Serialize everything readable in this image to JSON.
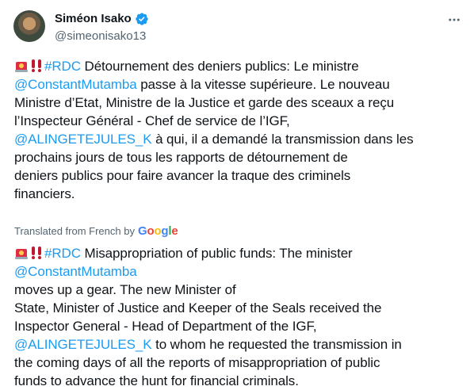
{
  "author": {
    "name": "Siméon Isako",
    "handle": "@simeonisako13"
  },
  "icons": {
    "siren": "police-car-light",
    "exclaim": "double-exclamation",
    "verified": "verified-badge",
    "more": "more-dots"
  },
  "colors": {
    "link": "#1d9bf0",
    "muted": "#536471",
    "text": "#0f1419"
  },
  "original": {
    "hashtag": "#RDC",
    "p1": " Détournement des deniers publics: Le ministre\n",
    "mention1": "@ConstantMutamba",
    "p2": " passe à la vitesse supérieure. Le nouveau\nMinistre d’Etat, Ministre de la Justice et garde des sceaux a reçu\nl’Inspecteur Général - Chef de service de l’IGF,\n",
    "mention2": "@ALINGETEJULES_K",
    "p3": " à qui, il a demandé la transmission dans les\nprochains jours de tous les rapports de détournement de\ndeniers publics pour faire avancer la traque des criminels\nfinanciers."
  },
  "translation": {
    "label": "Translated from French by",
    "provider": "Google"
  },
  "translated": {
    "hashtag": "#RDC",
    "p1": " Misappropriation of public funds: The minister\n",
    "mention1": "@ConstantMutamba",
    "p2": "\nmoves up a gear. The new Minister of\nState, Minister of Justice and Keeper of the Seals received the\nInspector General - Head of Department of the IGF,\n",
    "mention2": "@ALINGETEJULES_K",
    "p3": " to whom he requested the transmission in\nthe coming days of all the reports of misappropriation of public\nfunds to advance the hunt for financial criminals."
  }
}
